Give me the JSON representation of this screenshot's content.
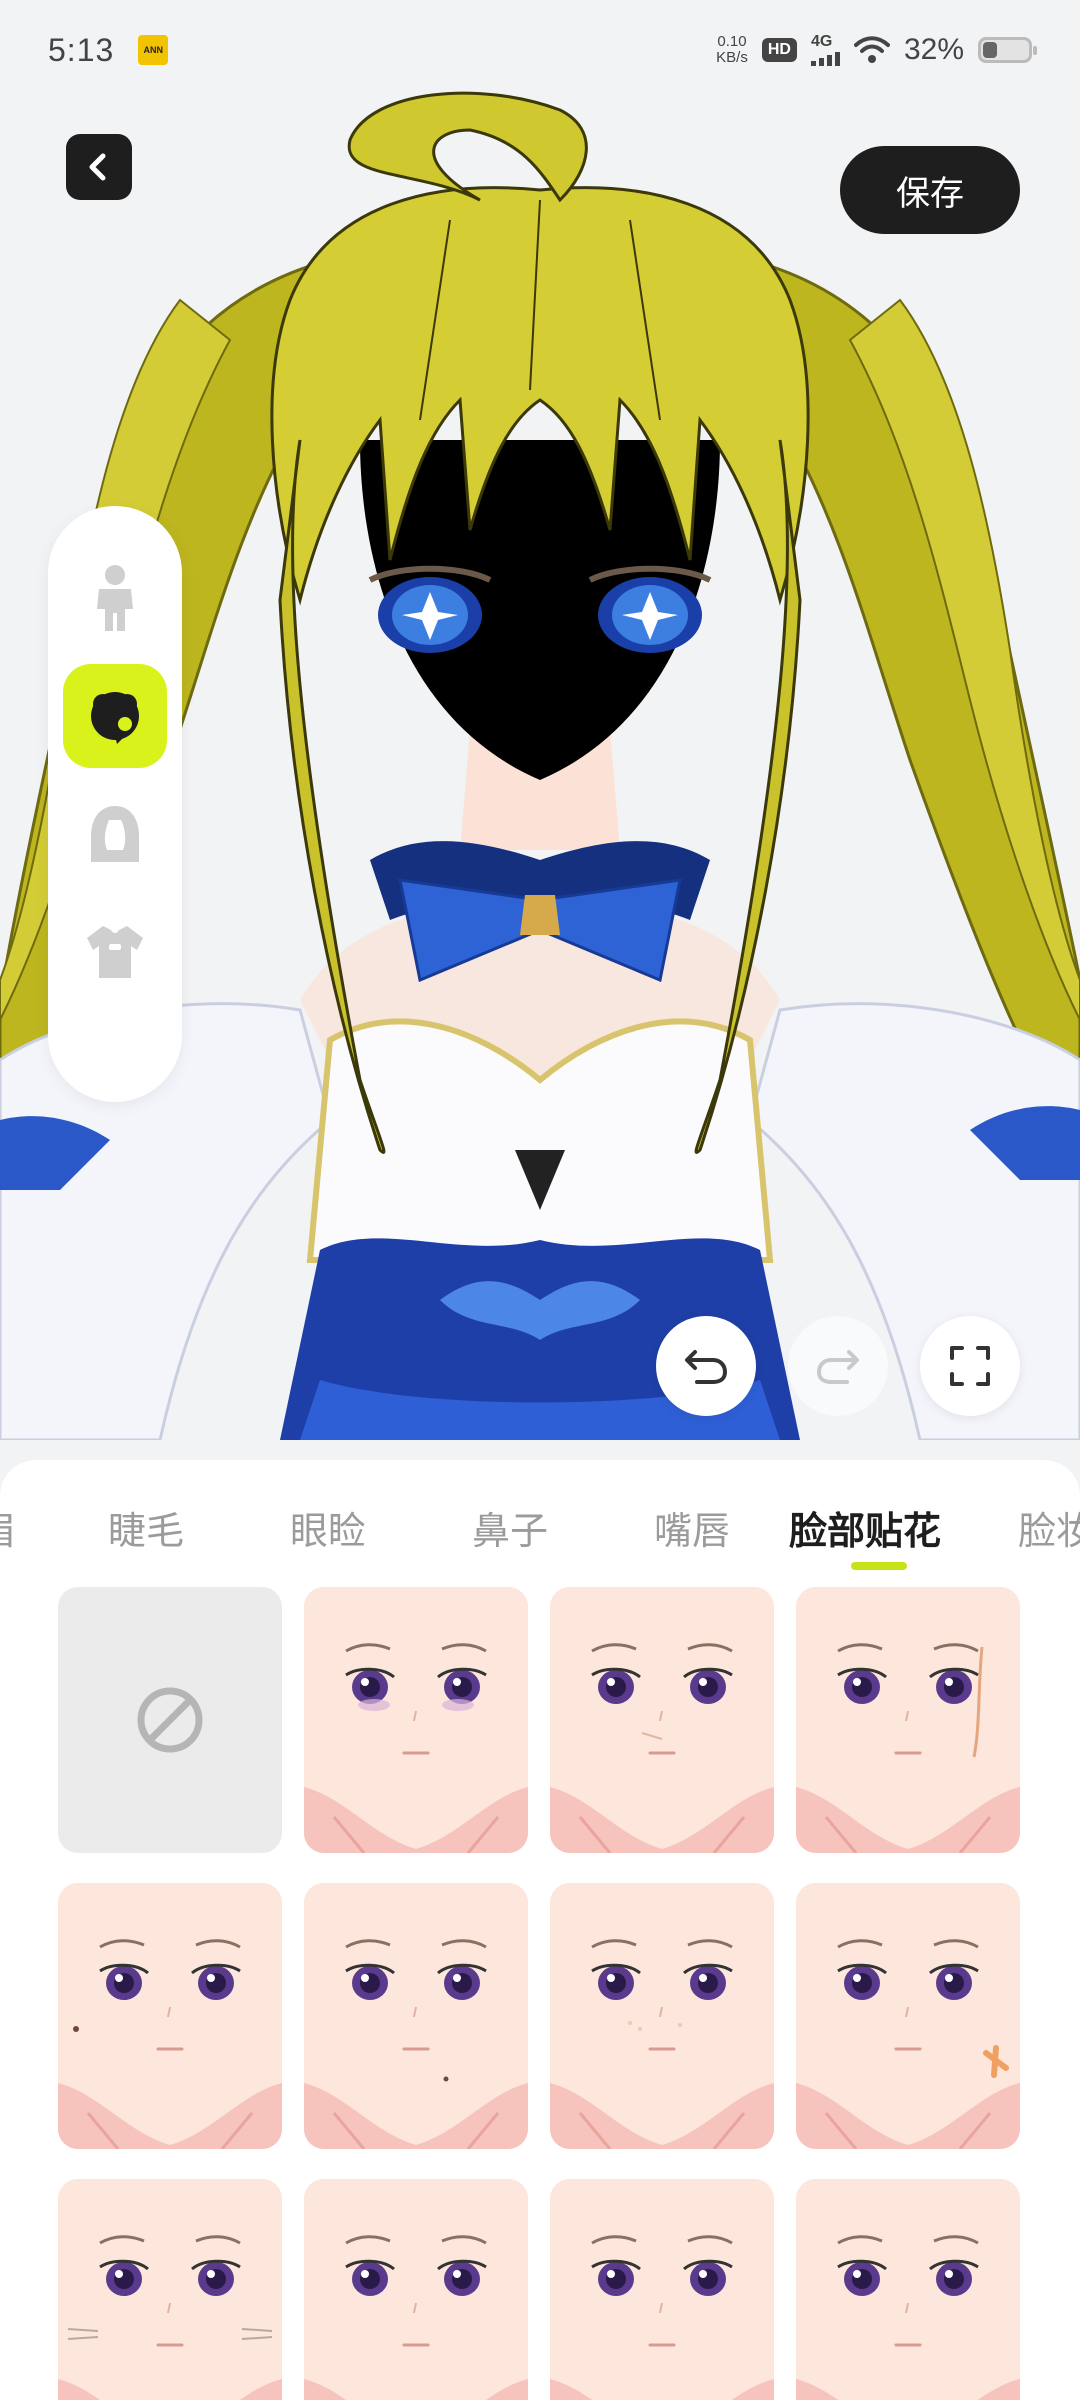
{
  "status_bar": {
    "time": "5:13",
    "app_icon_text": "ANN",
    "speed_value": "0.10",
    "speed_unit": "KB/s",
    "hd": "HD",
    "network": "4G",
    "battery_percent": "32%",
    "battery_level": 0.32
  },
  "header": {
    "save_label": "保存"
  },
  "side_menu": {
    "items": [
      {
        "name": "body-icon",
        "active": false
      },
      {
        "name": "face-makeup-icon",
        "active": true
      },
      {
        "name": "hair-icon",
        "active": false
      },
      {
        "name": "clothing-icon",
        "active": false
      }
    ]
  },
  "tabs": {
    "items": [
      "眉",
      "睫毛",
      "眼睑",
      "鼻子",
      "嘴唇",
      "脸部贴花",
      "脸妆"
    ],
    "active_index": 5
  },
  "grid": {
    "items": [
      {
        "label": "none",
        "type": "none"
      },
      {
        "label": "decal-1",
        "type": "face"
      },
      {
        "label": "decal-2",
        "type": "face"
      },
      {
        "label": "decal-3",
        "type": "face"
      },
      {
        "label": "decal-4",
        "type": "face"
      },
      {
        "label": "decal-5",
        "type": "face"
      },
      {
        "label": "decal-6",
        "type": "face"
      },
      {
        "label": "decal-7",
        "type": "face"
      },
      {
        "label": "decal-8",
        "type": "face"
      },
      {
        "label": "decal-9",
        "type": "face"
      },
      {
        "label": "decal-10",
        "type": "face"
      },
      {
        "label": "decal-11",
        "type": "face"
      }
    ]
  },
  "colors": {
    "accent": "#d9f21b",
    "indicator": "#c8e21a",
    "dark": "#1e1e1e",
    "hair": "#c9c22a",
    "outfit_blue": "#1f3fa8"
  }
}
